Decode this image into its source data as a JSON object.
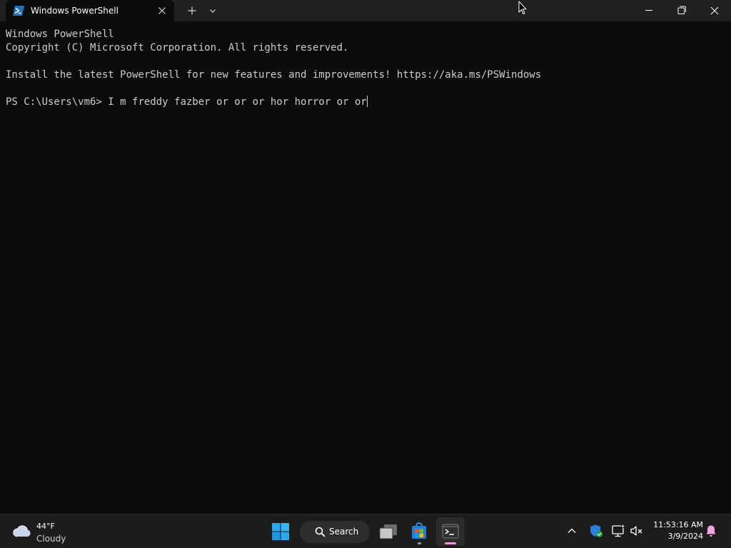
{
  "window": {
    "tab_title": "Windows PowerShell",
    "tab_icon": "powershell-icon",
    "buttons": {
      "tab_close": "close-icon",
      "new_tab": "plus-icon",
      "dropdown": "chevron-down-icon",
      "minimize": "minimize-icon",
      "maximize": "restore-icon",
      "close": "close-icon"
    }
  },
  "terminal": {
    "lines": [
      "Windows PowerShell",
      "Copyright (C) Microsoft Corporation. All rights reserved.",
      "",
      "Install the latest PowerShell for new features and improvements! https://aka.ms/PSWindows",
      ""
    ],
    "prompt": "PS C:\\Users\\vm6> ",
    "input": "I m freddy fazber or or or hor horror or or"
  },
  "taskbar": {
    "weather": {
      "temp": "44°F",
      "condition": "Cloudy",
      "icon": "cloud-icon"
    },
    "search_label": "Search",
    "apps": [
      "windows-start-icon",
      "search-icon",
      "task-view-icon",
      "microsoft-store-icon",
      "terminal-icon"
    ],
    "tray": {
      "icons": [
        "chevron-up-icon",
        "windows-security-icon",
        "network-icon",
        "volume-muted-icon"
      ]
    },
    "clock": {
      "time": "11:53:16 AM",
      "date": "3/9/2024"
    },
    "notification_icon": "bell-icon"
  },
  "colors": {
    "terminal_bg": "#0c0c0c",
    "terminal_text": "#cccccc",
    "titlebar_bg": "#202020",
    "taskbar_bg": "#1c1c1c",
    "accent_pink": "#ea9bd9"
  }
}
